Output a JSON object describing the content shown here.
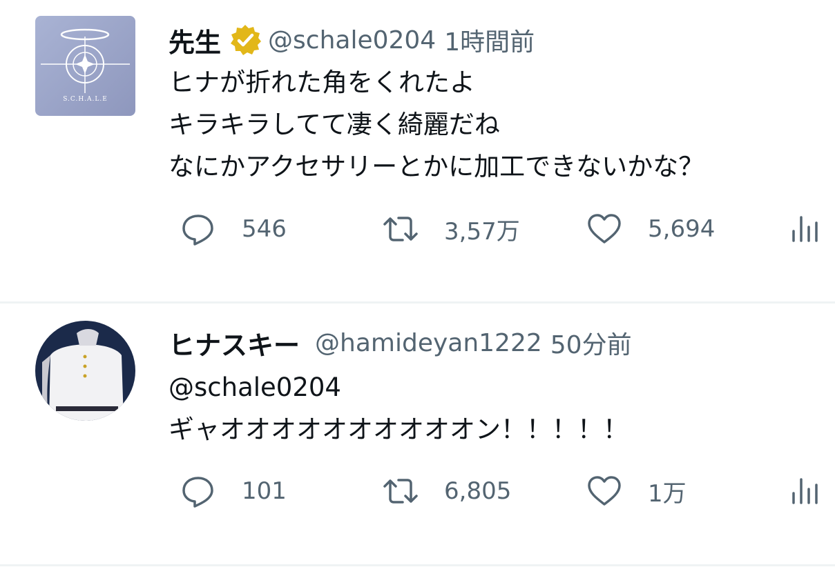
{
  "tweets": [
    {
      "display_name": "先生",
      "handle": "@schale0204",
      "time": "1時間前",
      "lines": [
        "ヒナが折れた角をくれたよ",
        "キラキラしてて凄く綺麗だね",
        "なにかアクセサリーとかに加工できないかな？"
      ],
      "replies": "546",
      "retweets": "3,57万",
      "likes": "5,694",
      "verified": true,
      "avatar_caption": "S.C.H.A.L.E"
    },
    {
      "display_name": "ヒナスキー",
      "handle": "@hamideyan1222",
      "time": "50分前",
      "lines": [
        "@schale0204",
        "ギャオオオオオオオオオオン！！！！！"
      ],
      "replies": "101",
      "retweets": "6,805",
      "likes": "1万",
      "verified": false
    }
  ],
  "icons": {
    "reply": "speech-bubble-icon",
    "retweet": "retweet-arrows-icon",
    "like": "heart-icon",
    "analytics": "bar-chart-icon",
    "verified": "gold-verified-badge-icon"
  },
  "colors": {
    "text_primary": "#0f1419",
    "text_secondary": "#536471",
    "verified_gold": "#e2b719",
    "divider": "#eff3f4"
  }
}
